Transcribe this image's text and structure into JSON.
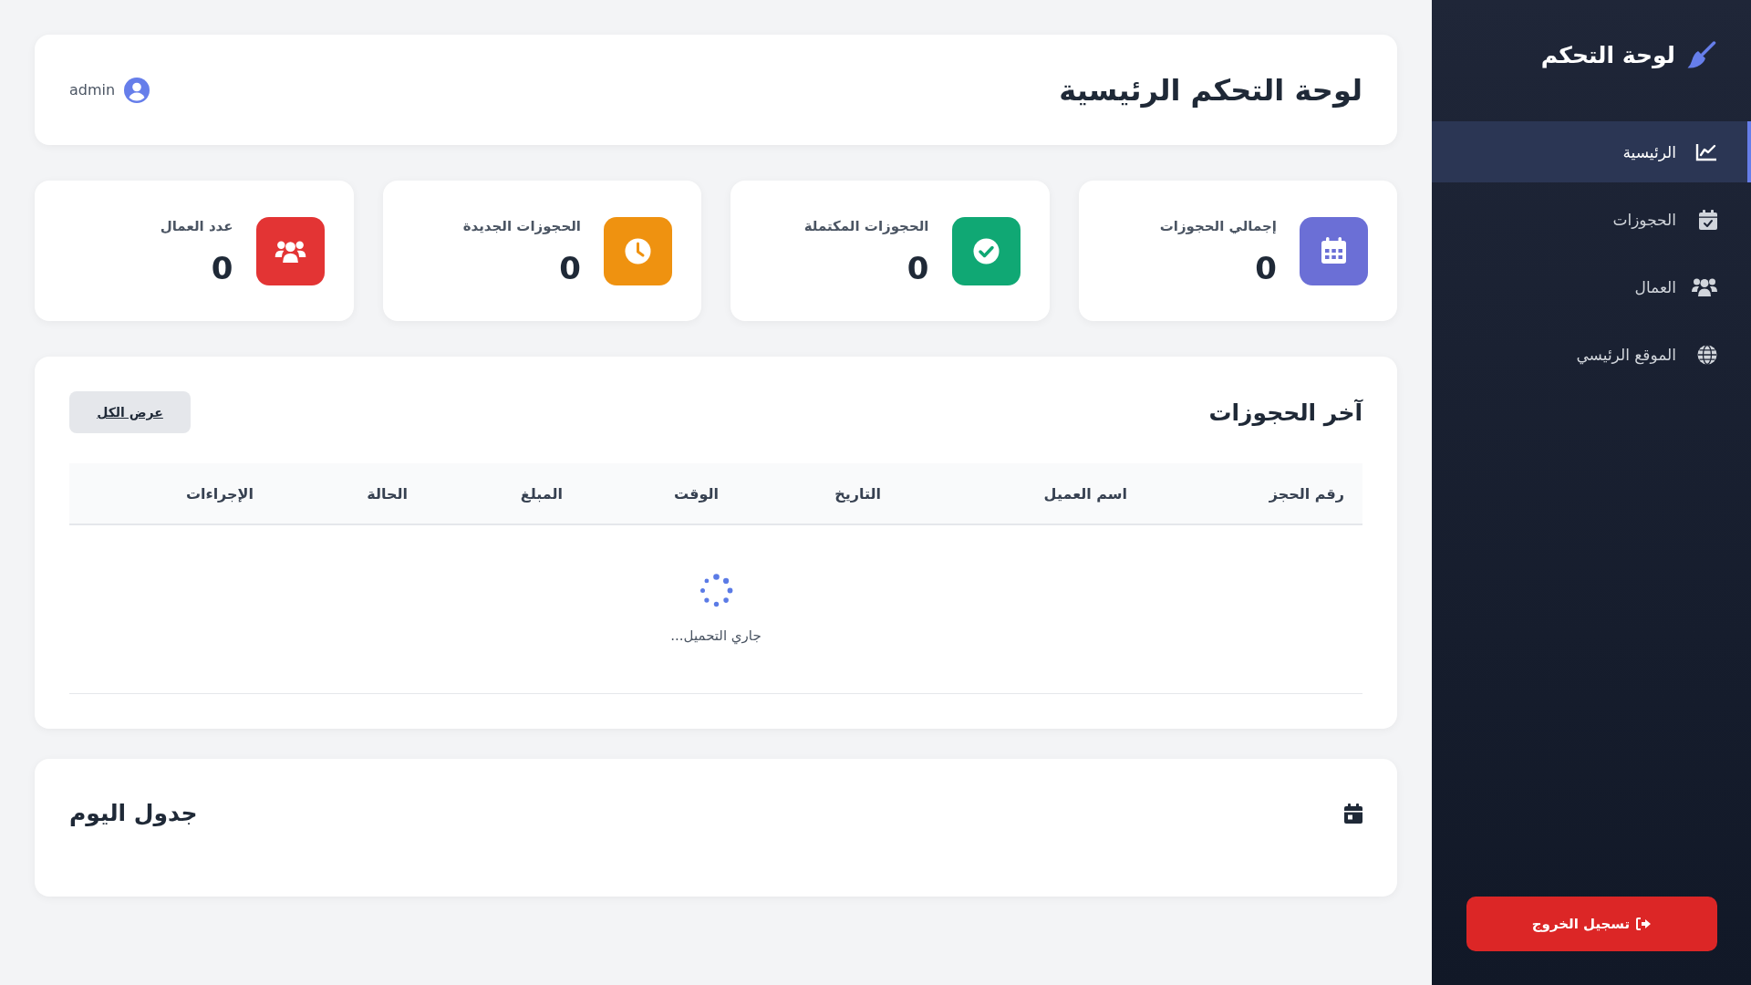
{
  "sidebar": {
    "title": "لوحة التحكم",
    "items": [
      {
        "label": "الرئيسية",
        "selected": true
      },
      {
        "label": "الحجوزات",
        "selected": false
      },
      {
        "label": "العمال",
        "selected": false
      },
      {
        "label": "الموقع الرئيسي",
        "selected": false
      }
    ],
    "logout_button": "تسجيل الخروج"
  },
  "header": {
    "title": "لوحة التحكم الرئيسية",
    "user": "admin"
  },
  "stats": [
    {
      "label": "إجمالي الحجوزات",
      "value": "0",
      "color": "#6b6fd6"
    },
    {
      "label": "الحجوزات المكتملة",
      "value": "0",
      "color": "#10a874"
    },
    {
      "label": "الحجوزات الجديدة",
      "value": "0",
      "color": "#ef9210"
    },
    {
      "label": "عدد العمال",
      "value": "0",
      "color": "#e33434"
    }
  ],
  "recent_bookings": {
    "title": "آخر الحجوزات",
    "view_all_button": "عرض الكل",
    "columns": [
      "رقم الحجز",
      "اسم العميل",
      "التاريخ",
      "الوقت",
      "المبلغ",
      "الحالة",
      "الإجراءات"
    ],
    "loading_text": "جاري التحميل..."
  },
  "schedule": {
    "title": "جدول اليوم"
  }
}
